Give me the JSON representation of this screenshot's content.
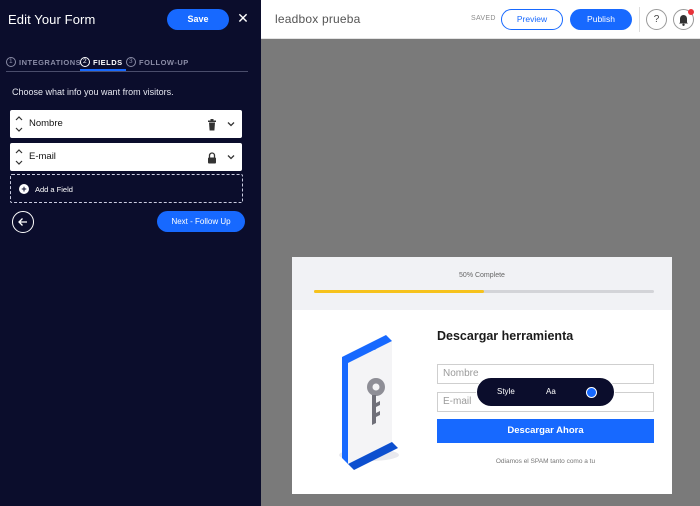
{
  "sidebar": {
    "title": "Edit Your Form",
    "save_label": "Save",
    "close_symbol": "✕",
    "tabs": [
      {
        "num": "1",
        "label": "INTEGRATIONS"
      },
      {
        "num": "2",
        "label": "FIELDS"
      },
      {
        "num": "3",
        "label": "FOLLOW-UP"
      }
    ],
    "active_tab": "FIELDS",
    "instruction": "Choose what info you want from visitors.",
    "fields": [
      {
        "label": "Nombre",
        "icon": "trash-icon"
      },
      {
        "label": "E-mail",
        "icon": "lock-icon"
      }
    ],
    "add_field_label": "Add a Field",
    "next_label": "Next - Follow Up"
  },
  "topbar": {
    "project_name": "leadbox prueba",
    "status": "SAVED",
    "preview_label": "Preview",
    "publish_label": "Publish",
    "help_symbol": "?"
  },
  "leadbox": {
    "progress_text": "50% Complete",
    "progress_fraction": 0.5,
    "title": "Descargar herramienta",
    "inputs": [
      {
        "placeholder": "Nombre"
      },
      {
        "placeholder": "E-mail"
      }
    ],
    "submit_label": "Descargar Ahora",
    "note": "Odiamos el SPAM tanto como a tu"
  },
  "style_toolbar": {
    "style_label": "Style",
    "font_label": "Aa",
    "color": "#1769ff"
  },
  "colors": {
    "accent": "#1769ff",
    "sidebar_bg": "#0b0d2c",
    "progress": "#f6c21c",
    "canvas": "#7a7a7a"
  }
}
